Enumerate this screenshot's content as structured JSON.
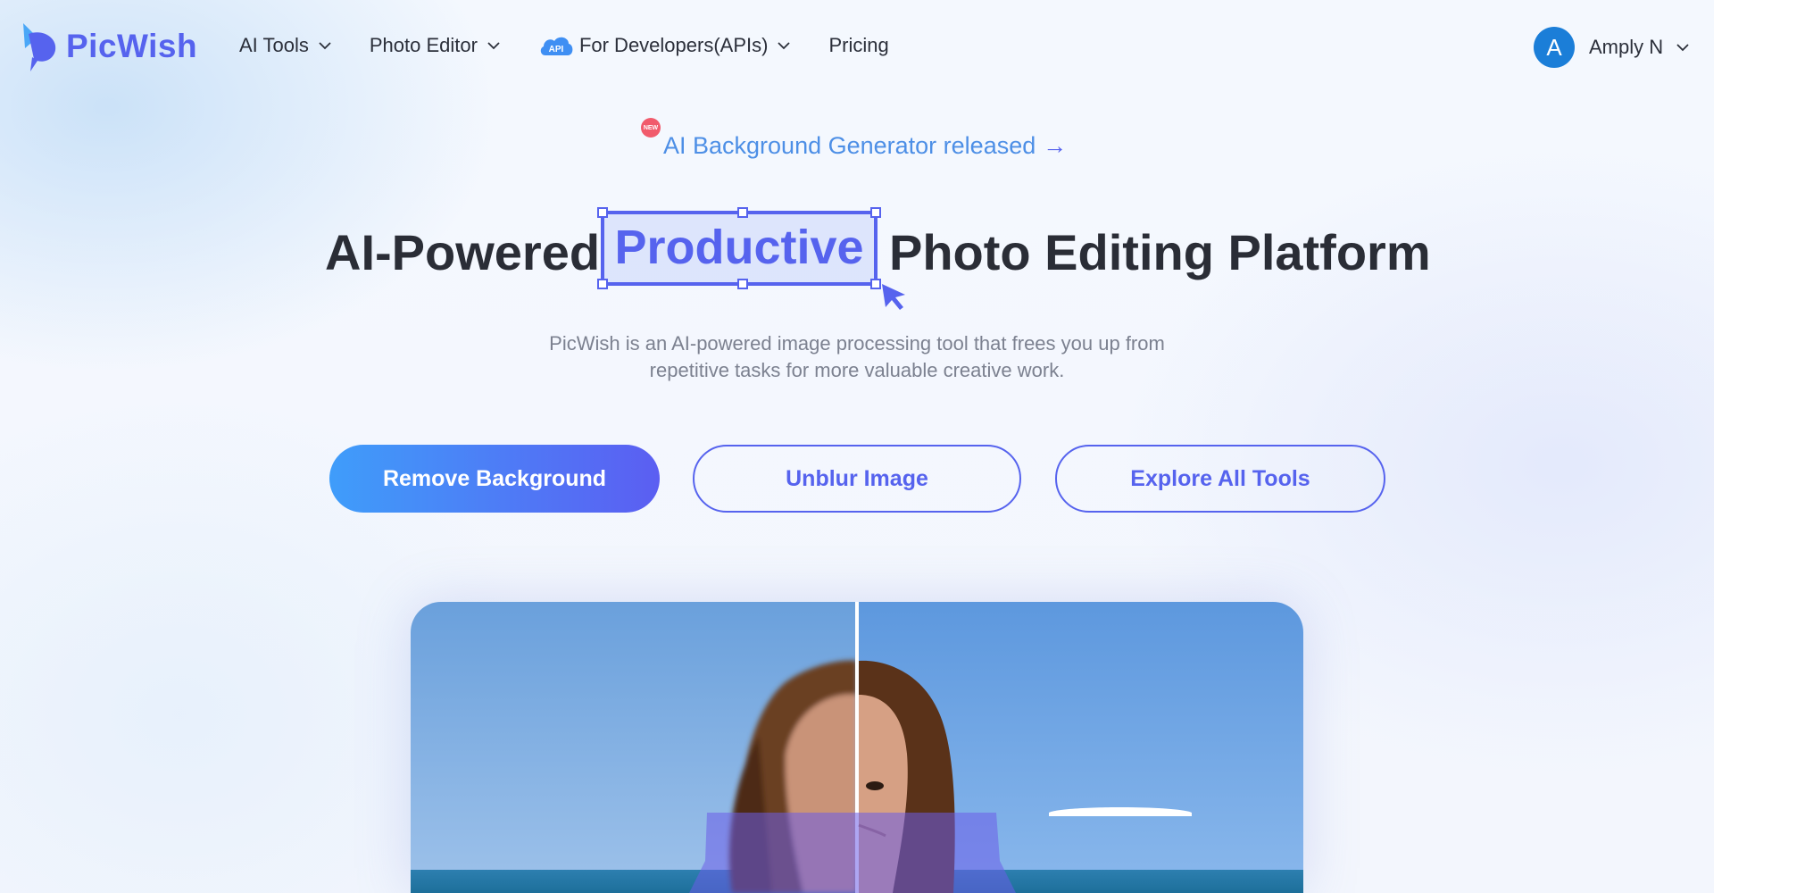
{
  "header": {
    "logo_text": "PicWish",
    "nav": [
      {
        "label": "AI Tools",
        "has_dropdown": true
      },
      {
        "label": "Photo Editor",
        "has_dropdown": true
      },
      {
        "label": "For Developers(APIs)",
        "has_dropdown": true,
        "badge": "API"
      },
      {
        "label": "Pricing",
        "has_dropdown": false
      }
    ],
    "user": {
      "initial": "A",
      "name": "Amply N"
    }
  },
  "announcement": {
    "badge": "NEW",
    "text": "AI Background Generator released",
    "arrow": "→"
  },
  "hero": {
    "title_before": "AI-Powered",
    "title_highlight": "Productive",
    "title_after": "Photo Editing Platform",
    "subtitle_line1": "PicWish is an AI-powered image processing tool that frees you up from",
    "subtitle_line2": "repetitive tasks for more valuable creative work."
  },
  "buttons": {
    "remove_bg": "Remove Background",
    "unblur": "Unblur Image",
    "explore": "Explore All Tools"
  },
  "colors": {
    "brand": "#5663ee",
    "link_blue": "#4d8fe6",
    "avatar": "#1b7ed8",
    "new_badge": "#f15b6c"
  },
  "icons": {
    "logo": "picwish-logo-icon",
    "dropdown": "chevron-down-icon",
    "api": "api-cloud-icon",
    "cursor": "cursor-arrow-icon"
  }
}
